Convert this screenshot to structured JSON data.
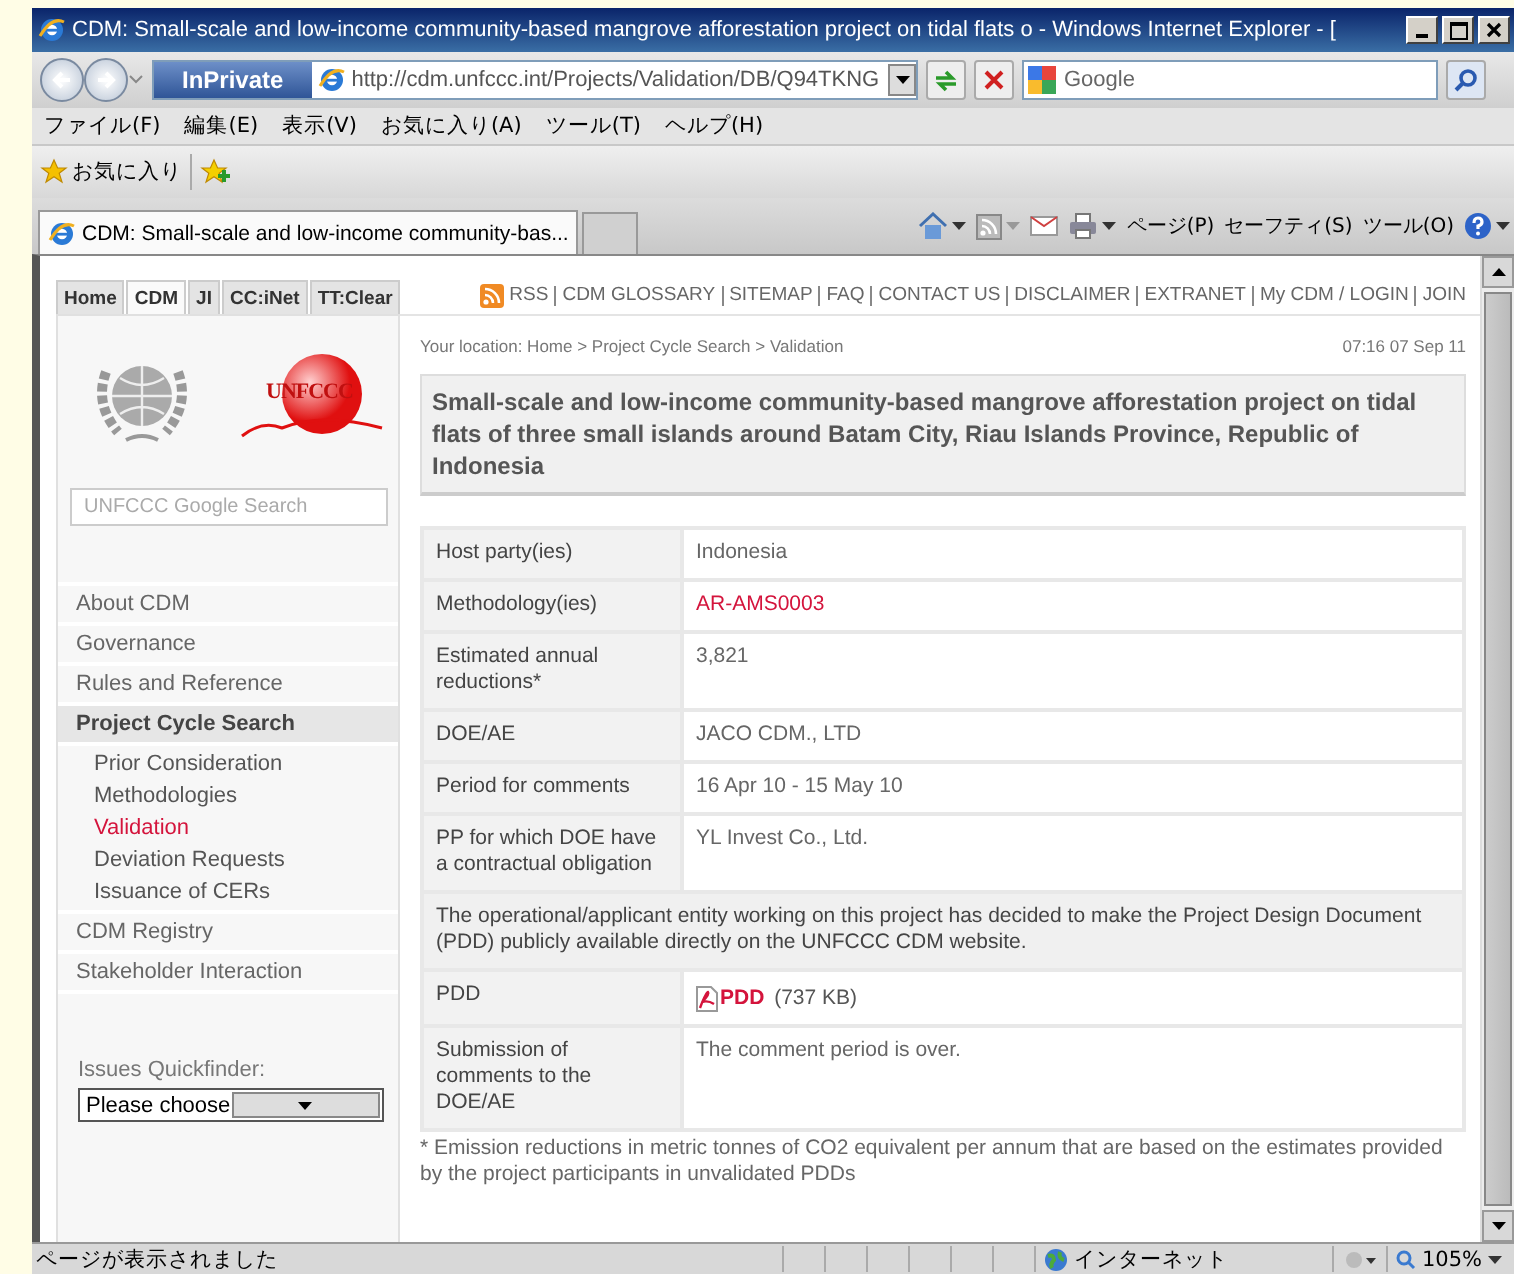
{
  "browser": {
    "title": "CDM: Small-scale and low-income community-based mangrove afforestation project on tidal flats o - Windows Internet Explorer - [",
    "inprivate": "InPrivate",
    "url": "http://cdm.unfccc.int/Projects/Validation/DB/Q94TKNG",
    "search": {
      "placeholder": "Google"
    },
    "menu": [
      "ファイル(F)",
      "編集(E)",
      "表示(V)",
      "お気に入り(A)",
      "ツール(T)",
      "ヘルプ(H)"
    ],
    "favorites": "お気に入り",
    "tabs": [
      {
        "label": "CDM: Small-scale and low-income community-bas...",
        "selected": true
      }
    ],
    "commands": [
      "ページ(P)",
      "セーフティ(S)",
      "ツール(O)"
    ],
    "status": "ページが表示されました",
    "zone": "インターネット",
    "zoom": "105%"
  },
  "page": {
    "site_tabs": [
      {
        "label": "Home",
        "selected": false
      },
      {
        "label": "CDM",
        "selected": true
      },
      {
        "label": "JI",
        "selected": false
      },
      {
        "label": "CC:iNet",
        "selected": false
      },
      {
        "label": "TT:Clear",
        "selected": false
      }
    ],
    "top_links": [
      "RSS",
      "CDM GLOSSARY",
      "SITEMAP",
      "FAQ",
      "CONTACT US",
      "DISCLAIMER",
      "EXTRANET",
      "My CDM / LOGIN",
      "JOIN"
    ],
    "logo_text": "UNFCCC",
    "search": {
      "placeholder": "UNFCCC Google Search"
    },
    "nav": [
      {
        "label": "About CDM",
        "selected": false
      },
      {
        "label": "Governance",
        "selected": false
      },
      {
        "label": "Rules and Reference",
        "selected": false
      },
      {
        "label": "Project Cycle Search",
        "selected": true,
        "children": [
          {
            "label": "Prior Consideration",
            "selected": false
          },
          {
            "label": "Methodologies",
            "selected": false
          },
          {
            "label": "Validation",
            "selected": true
          },
          {
            "label": "Deviation Requests",
            "selected": false
          },
          {
            "label": "Issuance of CERs",
            "selected": false
          }
        ]
      },
      {
        "label": "CDM Registry",
        "selected": false
      },
      {
        "label": "Stakeholder Interaction",
        "selected": false
      }
    ],
    "quickfinder": {
      "label": "Issues Quickfinder:",
      "value": "Please choose"
    },
    "location": "Your location: Home > Project Cycle Search > Validation",
    "timestamp": "07:16 07 Sep 11",
    "title": "Small-scale and low-income community-based mangrove afforestation project on tidal flats of three small islands around Batam City, Riau Islands Province, Republic of Indonesia",
    "rows": [
      {
        "kind": "text",
        "label": "Host party(ies)",
        "value": "Indonesia"
      },
      {
        "kind": "link",
        "label": "Methodology(ies)",
        "value": "AR-AMS0003"
      },
      {
        "kind": "text",
        "label": "Estimated annual reductions*",
        "value": "3,821"
      },
      {
        "kind": "text",
        "label": "DOE/AE",
        "value": "JACO CDM., LTD"
      },
      {
        "kind": "text",
        "label": "Period for comments",
        "value": "16 Apr 10 - 15 May 10"
      },
      {
        "kind": "text",
        "label": "PP for which DOE have a contractual obligation",
        "value": "YL Invest Co., Ltd."
      },
      {
        "kind": "notice",
        "value": "The operational/applicant entity working on this project has decided to make the Project Design Document (PDD) publicly available directly on the UNFCCC CDM website."
      },
      {
        "kind": "file",
        "label": "PDD",
        "value": "PDD",
        "size": "(737 KB)"
      },
      {
        "kind": "text",
        "label": "Submission of comments to the DOE/AE",
        "value": "The comment period is over."
      }
    ],
    "footnote": "* Emission reductions in metric tonnes of CO2 equivalent per annum that are based on the estimates provided by the project participants in unvalidated PDDs"
  }
}
